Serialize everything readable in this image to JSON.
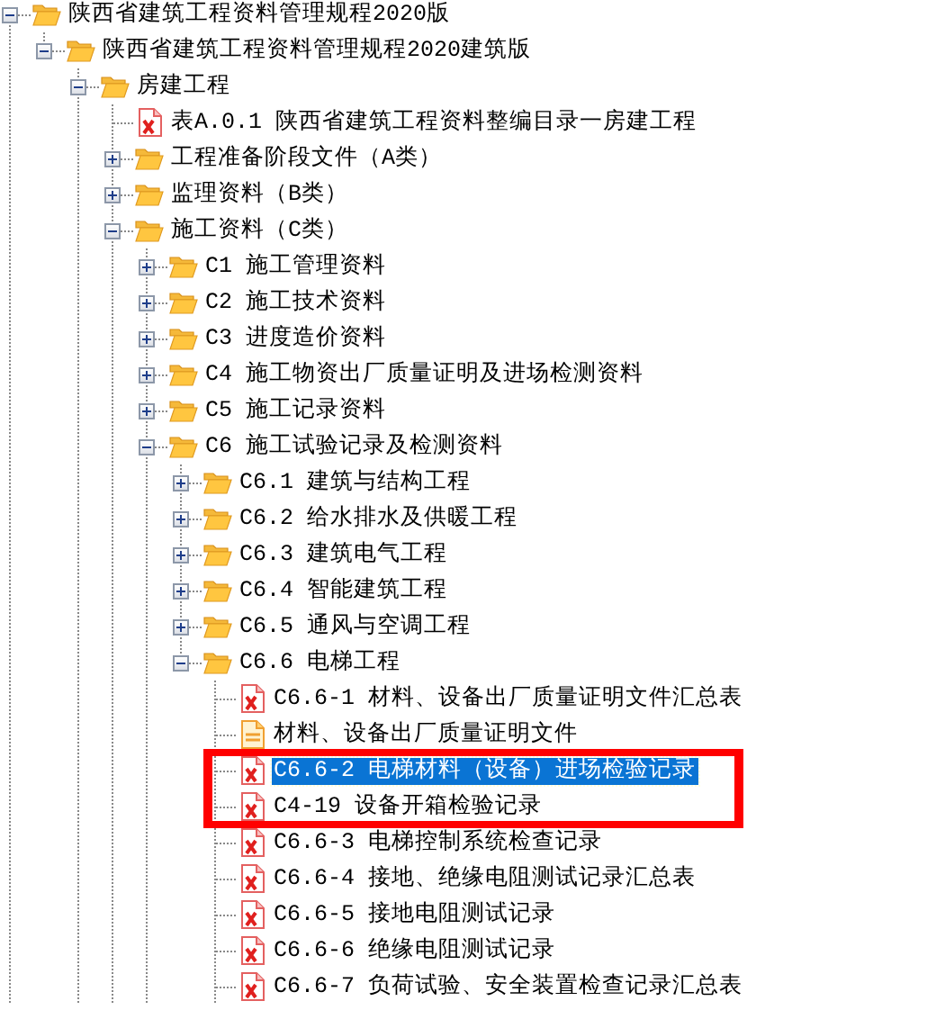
{
  "tree": [
    {
      "kind": "folder",
      "label": "陕西省建筑工程资料管理规程2020版",
      "expanded": true,
      "selected": false,
      "framed": false,
      "more_below": true,
      "children": [
        {
          "kind": "folder",
          "label": "陕西省建筑工程资料管理规程2020建筑版",
          "expanded": true,
          "selected": false,
          "framed": false,
          "more_below": false,
          "children": [
            {
              "kind": "folder",
              "label": "房建工程",
              "expanded": true,
              "selected": false,
              "framed": false,
              "more_below": true,
              "children": [
                {
                  "kind": "file",
                  "label": "表A.0.1 陕西省建筑工程资料整编目录一房建工程",
                  "selected": false,
                  "framed": false
                },
                {
                  "kind": "folder",
                  "label": "工程准备阶段文件（A类）",
                  "expanded": false,
                  "selected": false,
                  "framed": false
                },
                {
                  "kind": "folder",
                  "label": "监理资料（B类）",
                  "expanded": false,
                  "selected": false,
                  "framed": false
                },
                {
                  "kind": "folder",
                  "label": "施工资料（C类）",
                  "expanded": true,
                  "selected": false,
                  "framed": false,
                  "more_below": true,
                  "children": [
                    {
                      "kind": "folder",
                      "label": "C1 施工管理资料",
                      "expanded": false,
                      "selected": false,
                      "framed": false
                    },
                    {
                      "kind": "folder",
                      "label": "C2 施工技术资料",
                      "expanded": false,
                      "selected": false,
                      "framed": false
                    },
                    {
                      "kind": "folder",
                      "label": "C3 进度造价资料",
                      "expanded": false,
                      "selected": false,
                      "framed": false
                    },
                    {
                      "kind": "folder",
                      "label": "C4 施工物资出厂质量证明及进场检测资料",
                      "expanded": false,
                      "selected": false,
                      "framed": false
                    },
                    {
                      "kind": "folder",
                      "label": "C5 施工记录资料",
                      "expanded": false,
                      "selected": false,
                      "framed": false
                    },
                    {
                      "kind": "folder",
                      "label": "C6 施工试验记录及检测资料",
                      "expanded": true,
                      "selected": false,
                      "framed": false,
                      "more_below": true,
                      "children": [
                        {
                          "kind": "folder",
                          "label": "C6.1 建筑与结构工程",
                          "expanded": false,
                          "selected": false,
                          "framed": false
                        },
                        {
                          "kind": "folder",
                          "label": "C6.2 给水排水及供暖工程",
                          "expanded": false,
                          "selected": false,
                          "framed": false
                        },
                        {
                          "kind": "folder",
                          "label": "C6.3 建筑电气工程",
                          "expanded": false,
                          "selected": false,
                          "framed": false
                        },
                        {
                          "kind": "folder",
                          "label": "C6.4 智能建筑工程",
                          "expanded": false,
                          "selected": false,
                          "framed": false
                        },
                        {
                          "kind": "folder",
                          "label": "C6.5 通风与空调工程",
                          "expanded": false,
                          "selected": false,
                          "framed": false
                        },
                        {
                          "kind": "folder",
                          "label": "C6.6 电梯工程",
                          "expanded": true,
                          "selected": false,
                          "framed": false,
                          "more_below": false,
                          "children": [
                            {
                              "kind": "file",
                              "label": "C6.6-1 材料、设备出厂质量证明文件汇总表",
                              "selected": false,
                              "framed": false
                            },
                            {
                              "kind": "doc",
                              "label": "材料、设备出厂质量证明文件",
                              "selected": false,
                              "framed": false
                            },
                            {
                              "kind": "file",
                              "label": "C6.6-2 电梯材料（设备）进场检验记录",
                              "selected": true,
                              "framed": true
                            },
                            {
                              "kind": "file",
                              "label": "C4-19 设备开箱检验记录",
                              "selected": false,
                              "framed": true
                            },
                            {
                              "kind": "file",
                              "label": "C6.6-3 电梯控制系统检查记录",
                              "selected": false,
                              "framed": false
                            },
                            {
                              "kind": "file",
                              "label": "C6.6-4 接地、绝缘电阻测试记录汇总表",
                              "selected": false,
                              "framed": false
                            },
                            {
                              "kind": "file",
                              "label": "C6.6-5 接地电阻测试记录",
                              "selected": false,
                              "framed": false
                            },
                            {
                              "kind": "file",
                              "label": "C6.6-6 绝缘电阻测试记录",
                              "selected": false,
                              "framed": false
                            },
                            {
                              "kind": "file",
                              "label": "C6.6-7 负荷试验、安全装置检查记录汇总表",
                              "selected": false,
                              "framed": false,
                              "more_below": true
                            }
                          ]
                        }
                      ]
                    }
                  ]
                }
              ]
            }
          ]
        }
      ]
    }
  ]
}
